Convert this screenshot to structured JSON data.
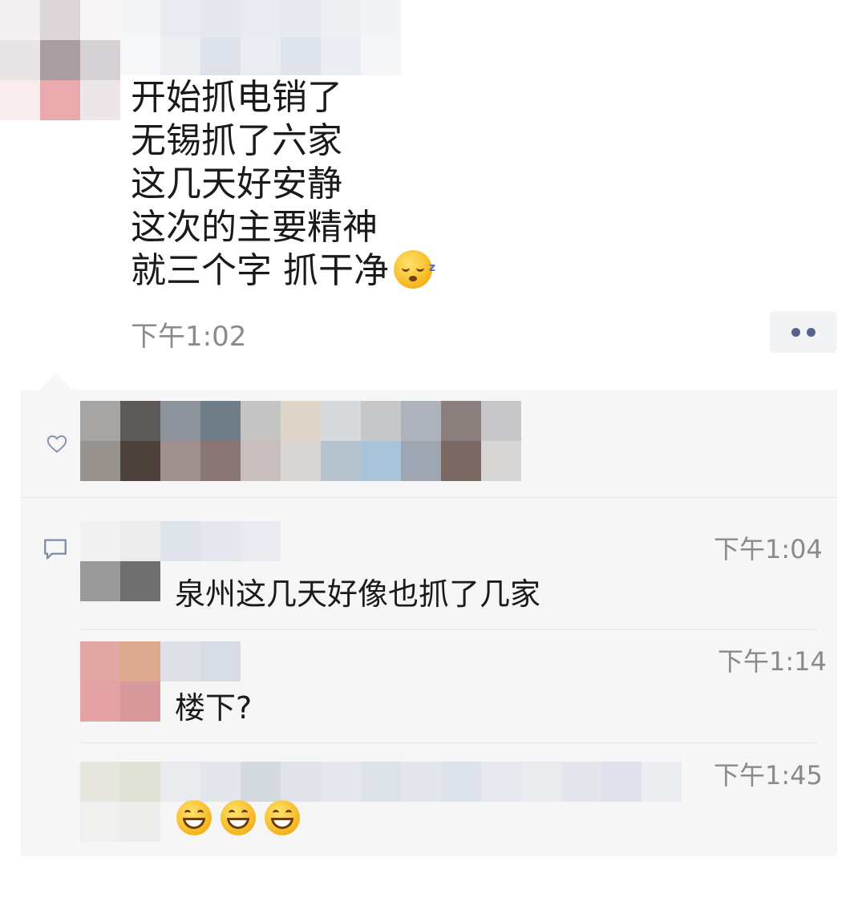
{
  "post": {
    "lines": [
      "开始抓电销了",
      "无锡抓了六家",
      "这几天好安静",
      "这次的主要精神",
      "就三个字 抓干净"
    ],
    "emoji": "sleeping-face-emoji",
    "time": "下午1:02"
  },
  "comments": [
    {
      "time": "下午1:04",
      "text": "泉州这几天好像也抓了几家"
    },
    {
      "time": "下午1:14",
      "text": "楼下?"
    },
    {
      "time": "下午1:45",
      "text": "",
      "emoji_count": 3
    }
  ],
  "icons": {
    "like": "heart-outline-icon",
    "comment": "comment-bubble-icon",
    "more": "more-dots-icon"
  },
  "colors": {
    "link_blue": "#56648a",
    "time_gray": "#8a8a8a",
    "panel_bg": "#f6f6f6"
  }
}
